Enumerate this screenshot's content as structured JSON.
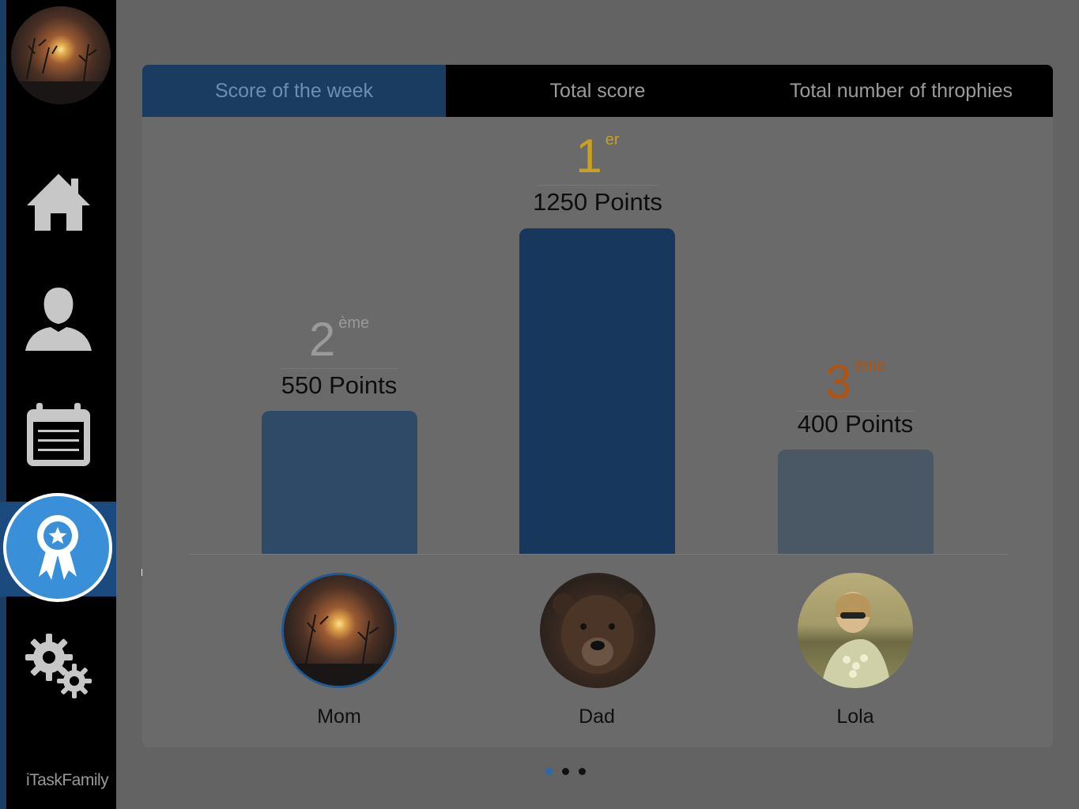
{
  "app": {
    "brand": "iTaskFamily"
  },
  "sidebar": {
    "items": [
      {
        "name": "home",
        "icon": "home-icon"
      },
      {
        "name": "profile",
        "icon": "person-icon"
      },
      {
        "name": "calendar",
        "icon": "calendar-icon"
      },
      {
        "name": "awards",
        "icon": "award-ribbon-icon",
        "active": true
      },
      {
        "name": "settings",
        "icon": "gears-icon"
      }
    ]
  },
  "overlay": {
    "step_number": "1"
  },
  "tabs": [
    {
      "label": "Score of the week",
      "active": true
    },
    {
      "label": "Total score",
      "active": false
    },
    {
      "label": "Total number of throphies",
      "active": false
    }
  ],
  "leaderboard": [
    {
      "name": "Mom",
      "rank": "2",
      "suffix": "ème",
      "points_label": "550 Points",
      "points": 550,
      "rank_color": "#9a9a9a",
      "bar_color": "#2f4a66"
    },
    {
      "name": "Dad",
      "rank": "1",
      "suffix": "er",
      "points_label": "1250 Points",
      "points": 1250,
      "rank_color": "#c9a020",
      "bar_color": "#17385c"
    },
    {
      "name": "Lola",
      "rank": "3",
      "suffix": "ème",
      "points_label": "400 Points",
      "points": 400,
      "rank_color": "#b05414",
      "bar_color": "#4a5866"
    }
  ],
  "pagination": {
    "current": 1,
    "total": 3
  },
  "colors": {
    "accent": "#3a90d8",
    "sidebar_bg": "#000000",
    "overlay_bg": "#636363"
  }
}
